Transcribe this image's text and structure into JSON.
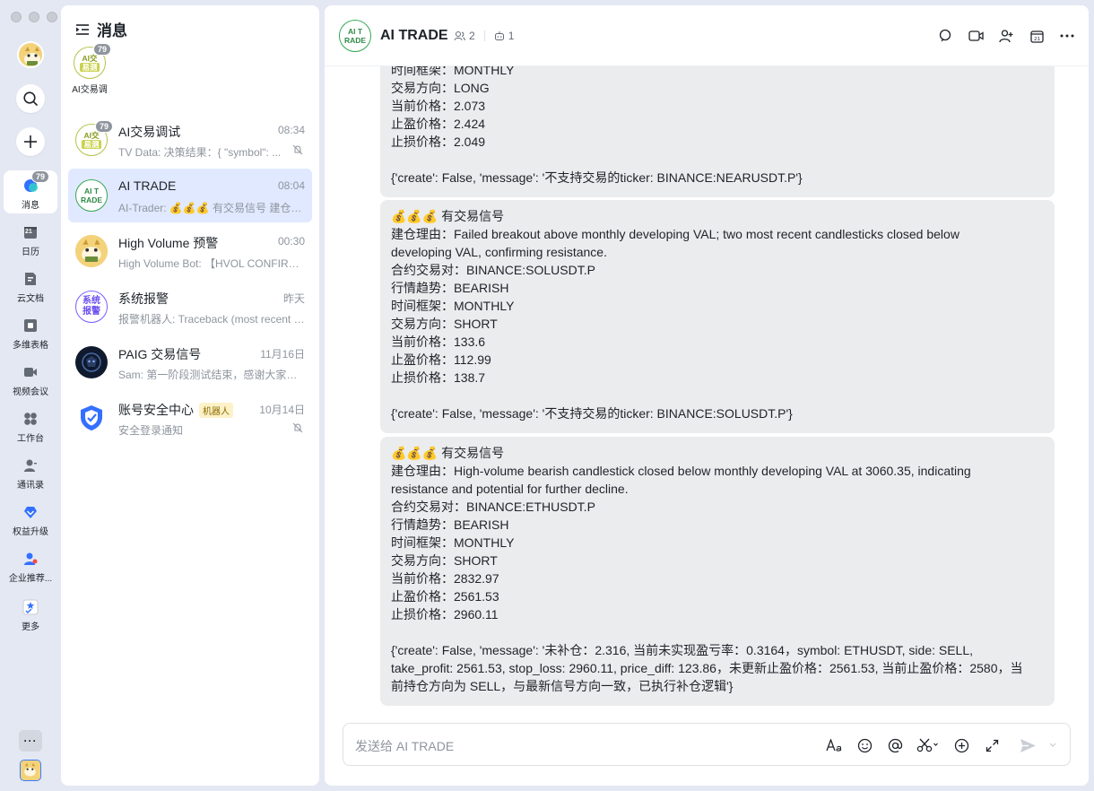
{
  "rail": {
    "nav": [
      {
        "label": "消息",
        "icon": "chat-icon",
        "badge": "79",
        "active": true
      },
      {
        "label": "日历",
        "icon": "calendar-icon",
        "badge": ""
      },
      {
        "label": "云文档",
        "icon": "docs-icon",
        "badge": ""
      },
      {
        "label": "多维表格",
        "icon": "table-icon",
        "badge": ""
      },
      {
        "label": "视频会议",
        "icon": "video-icon",
        "badge": ""
      },
      {
        "label": "工作台",
        "icon": "workspace-icon",
        "badge": ""
      },
      {
        "label": "通讯录",
        "icon": "contacts-icon",
        "badge": ""
      },
      {
        "label": "权益升级",
        "icon": "upgrade-icon",
        "badge": ""
      },
      {
        "label": "企业推荐...",
        "icon": "recommend-icon",
        "badge": ""
      },
      {
        "label": "更多",
        "icon": "more-apps-icon",
        "badge": ""
      }
    ],
    "calendar_day": "21",
    "more_label": "···"
  },
  "list": {
    "title": "消息",
    "pinned": {
      "label": "AI交易调",
      "badge": "79",
      "logo_l1": "AI交",
      "logo_l2": "易测"
    },
    "conversations": [
      {
        "name": "AI交易调试",
        "time": "08:34",
        "preview": "TV Data: 决策结果：{ \"symbol\": ...",
        "badge": "79",
        "muted": true,
        "logo_l1": "AI交",
        "logo_l2": "易测"
      },
      {
        "name": "AI TRADE",
        "time": "08:04",
        "preview": "AI-Trader: 💰💰💰 有交易信号 建仓理由：...",
        "muted": false,
        "logo_l1": "AI T",
        "logo_l2": "RADE"
      },
      {
        "name": "High Volume 预警",
        "time": "00:30",
        "preview": "High Volume Bot: 【HVOL CONFIRMED】...",
        "muted": false
      },
      {
        "name": "系统报警",
        "time": "昨天",
        "preview": "报警机器人: Traceback (most recent call last)...",
        "muted": false,
        "logo_l1": "系统",
        "logo_l2": "报警"
      },
      {
        "name": "PAIG 交易信号",
        "time": "11月16日",
        "preview": "Sam: 第一阶段测试结束，感谢大家的参与...",
        "muted": false
      },
      {
        "name": "账号安全中心",
        "tag": "机器人",
        "time": "10月14日",
        "preview": "安全登录通知",
        "muted": true
      }
    ]
  },
  "chat": {
    "title": "AI TRADE",
    "logo_l1": "AI T",
    "logo_l2": "RADE",
    "members": "2",
    "bots": "1",
    "messages": [
      {
        "lines": [
          "时间框架：MONTHLY",
          "交易方向：LONG",
          "当前价格：2.073",
          "止盈价格：2.424",
          "止损价格：2.049",
          "",
          "{'create': False, 'message': '不支持交易的ticker: BINANCE:NEARUSDT.P'}"
        ]
      },
      {
        "lines": [
          "💰💰💰 有交易信号",
          "建仓理由：Failed breakout above monthly developing VAL; two most recent candlesticks closed below",
          "developing VAL, confirming resistance.",
          "合约交易对：BINANCE:SOLUSDT.P",
          "行情趋势：BEARISH",
          "时间框架：MONTHLY",
          "交易方向：SHORT",
          "当前价格：133.6",
          "止盈价格：112.99",
          "止损价格：138.7",
          "",
          "{'create': False, 'message': '不支持交易的ticker: BINANCE:SOLUSDT.P'}"
        ]
      },
      {
        "lines": [
          "💰💰💰 有交易信号",
          "建仓理由：High-volume bearish candlestick closed below monthly developing VAL at 3060.35, indicating",
          "resistance and potential for further decline.",
          "合约交易对：BINANCE:ETHUSDT.P",
          "行情趋势：BEARISH",
          "时间框架：MONTHLY",
          "交易方向：SHORT",
          "当前价格：2832.97",
          "止盈价格：2561.53",
          "止损价格：2960.11",
          "",
          "{'create': False, 'message': '未补仓：2.316, 当前未实现盈亏率：0.3164，symbol: ETHUSDT, side: SELL,",
          "take_profit: 2561.53, stop_loss: 2960.11, price_diff: 123.86，未更新止盈价格：2561.53, 当前止盈价格：2580，当",
          "前持仓方向为 SELL，与最新信号方向一致，已执行补仓逻辑'}"
        ]
      }
    ],
    "composer": {
      "placeholder": "发送给 AI TRADE"
    }
  },
  "colors": {
    "accent": "#3370ff",
    "selected_bg": "#e0e9ff",
    "bubble_bg": "#ebecee",
    "logo_green": "#2e8b45"
  }
}
